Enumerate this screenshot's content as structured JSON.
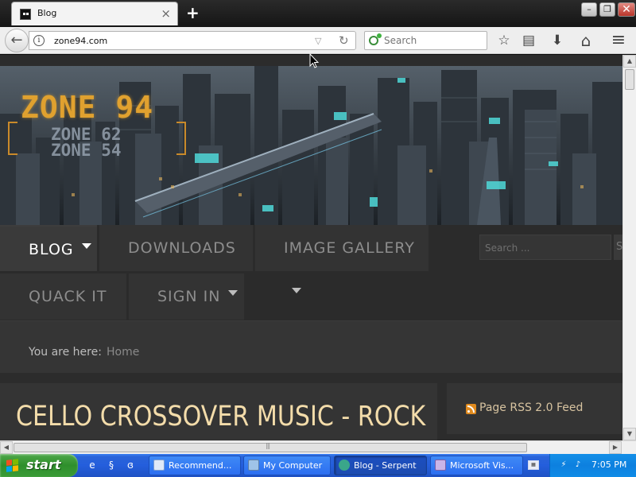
{
  "browser": {
    "tab": {
      "title": "Blog",
      "close": "×"
    },
    "new_tab": "+",
    "window_controls": {
      "minimize": "–",
      "maximize": "❐",
      "close": "✕"
    },
    "back": "←",
    "info": "i",
    "url": "zone94.com",
    "url_dropdown": "▽",
    "reload": "↻",
    "search_placeholder": "Search",
    "toolbar_icons": [
      "star-icon",
      "reading-list-icon",
      "download-icon",
      "home-icon",
      "menu-icon"
    ],
    "star": "☆",
    "reading": "▤",
    "download": "⬇",
    "home": "⌂",
    "menu": "≡"
  },
  "site": {
    "logo": {
      "main": "ZONE 94",
      "line2": "ZONE 62",
      "line3": "ZONE 54"
    },
    "menu": [
      {
        "label": "BLOG",
        "active": true,
        "has_caret": true
      },
      {
        "label": "DOWNLOADS",
        "active": false,
        "has_caret": true
      },
      {
        "label": "IMAGE GALLERY",
        "active": false,
        "has_caret": true
      },
      {
        "label": "QUACK IT",
        "active": false,
        "has_caret": false
      },
      {
        "label": "SIGN IN",
        "active": false,
        "has_caret": true
      }
    ],
    "search_placeholder": "Search ...",
    "search_button": "S",
    "breadcrumb": {
      "label": "You are here:",
      "home": "Home"
    },
    "article_title": "CELLO CROSSOVER MUSIC - ROCK",
    "rss": "Page RSS 2.0 Feed",
    "colors": {
      "accent_logo": "#e0a12f",
      "title": "#f3dcaa",
      "bg": "#2c2c2c"
    }
  },
  "taskbar": {
    "start": "start",
    "tasks": [
      {
        "label": "Recommend...",
        "icon": "notepad-icon",
        "active": false
      },
      {
        "label": "My Computer",
        "icon": "computer-icon",
        "active": false
      },
      {
        "label": "Blog - Serpent",
        "icon": "serpent-icon",
        "active": true
      },
      {
        "label": "Microsoft Vis...",
        "icon": "visual-studio-icon",
        "active": false
      }
    ],
    "clock": "7:05 PM"
  }
}
